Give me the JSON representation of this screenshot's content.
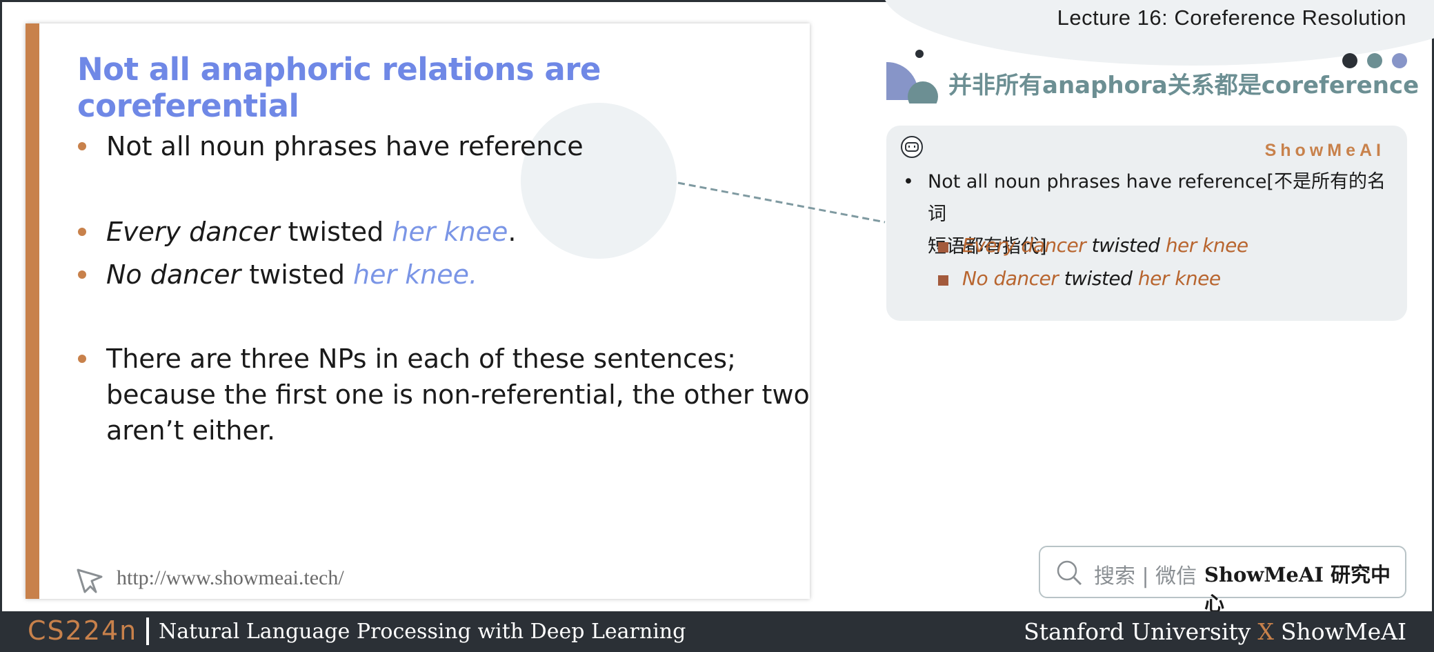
{
  "header": {
    "lecture_title": "Lecture 16: Coreference Resolution"
  },
  "slide": {
    "title": "Not all anaphoric relations  are coreferential",
    "bullet1": "Not all noun phrases have reference",
    "bullet2": {
      "a": "Every dancer",
      "b": " twisted ",
      "c": "her knee",
      "d": "."
    },
    "bullet3": {
      "a": "No dancer",
      "b": " twisted ",
      "c": "her knee."
    },
    "bullet4_lines": [
      "There are three NPs in each of these sentences;",
      "because the first one is non-referential, the other two",
      "aren’t either."
    ],
    "url": "http://www.showmeai.tech/"
  },
  "notes": {
    "cn_title": "并非所有anaphora关系都是coreference",
    "brand": "ShowMeAI",
    "bullet_line1": "Not all noun phrases have reference[不是所有的名词",
    "bullet_line2": "短语都有指代]",
    "sub1": {
      "a": "Every dancer",
      "b": " twisted ",
      "c": "her knee"
    },
    "sub2": {
      "a": "No dancer",
      "b": " twisted ",
      "c": "her knee"
    }
  },
  "search": {
    "label": "搜索 | 微信",
    "brand": "ShowMeAI 研究中心"
  },
  "footer": {
    "course": "CS224n",
    "course_name": "Natural Language Processing with Deep Learning",
    "uni_left": "Stanford University",
    "uni_x": "X",
    "uni_right": "ShowMeAI"
  },
  "colors": {
    "accent": "#c8814b",
    "title_blue": "#6f88e6",
    "teal": "#6c8f93",
    "footer_bg": "#2b3036"
  }
}
